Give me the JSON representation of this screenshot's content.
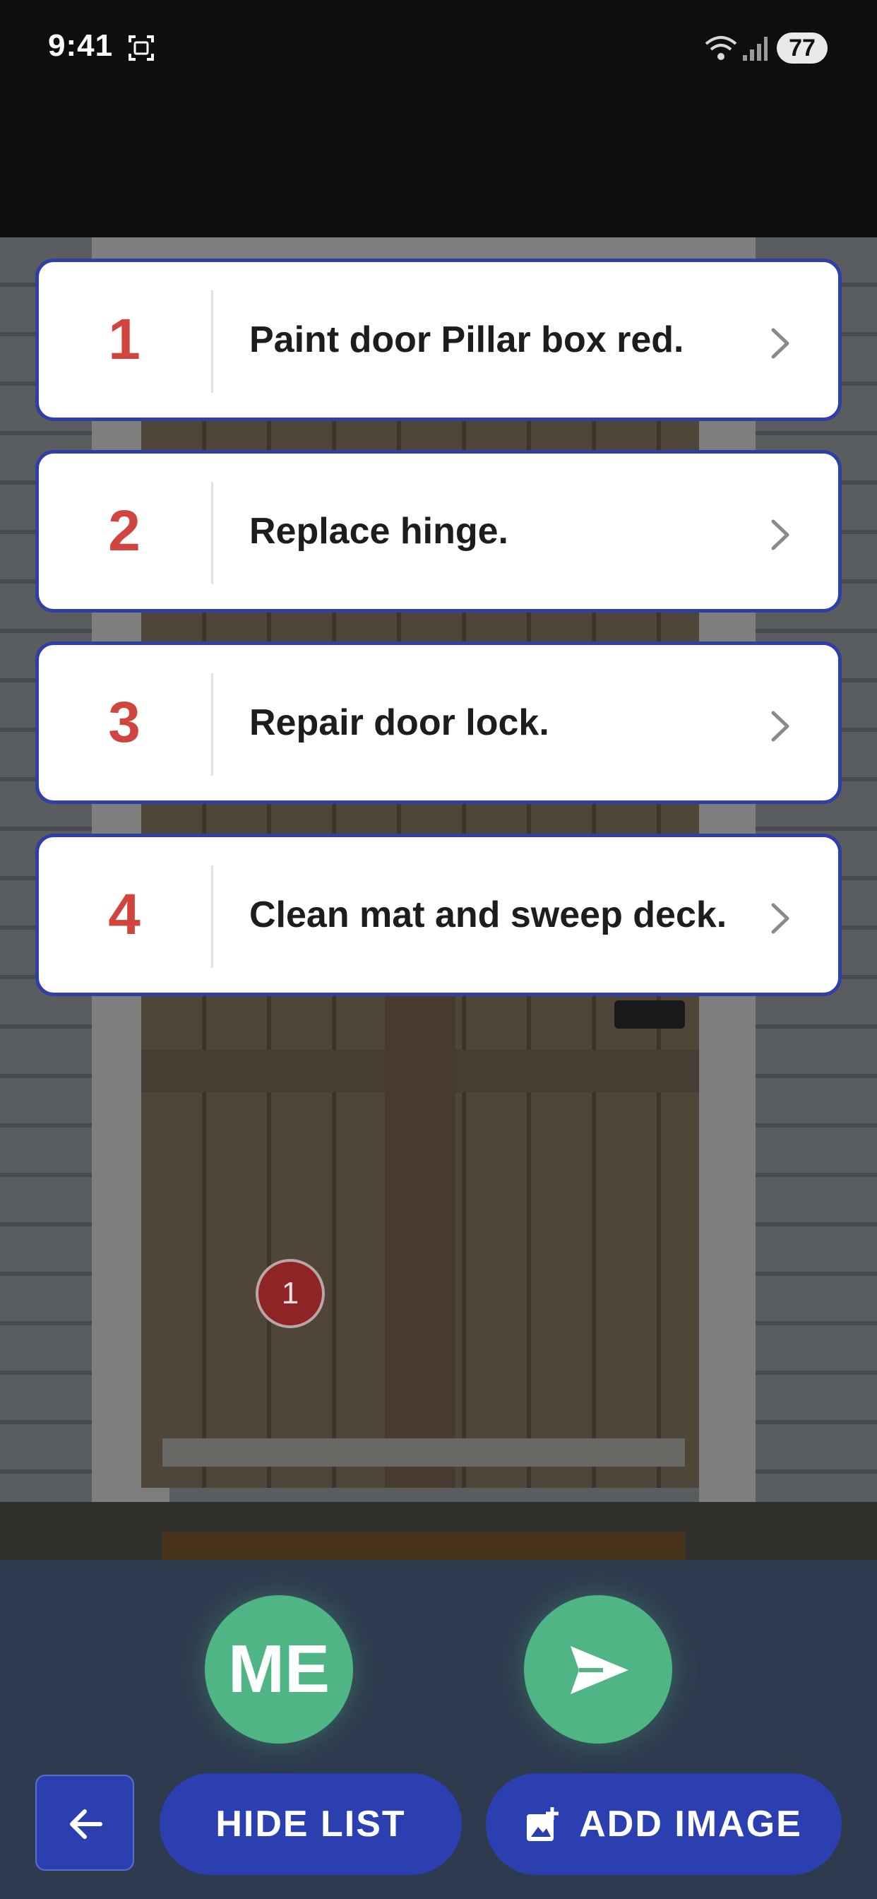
{
  "status_bar": {
    "time": "9:41",
    "battery": "77",
    "icons": [
      "screenshot-icon",
      "wifi-icon",
      "signal-icon",
      "battery-icon"
    ]
  },
  "photo_pin": {
    "label": "1"
  },
  "tasks": [
    {
      "number": "1",
      "label": "Paint door Pillar box red."
    },
    {
      "number": "2",
      "label": "Replace hinge."
    },
    {
      "number": "3",
      "label": "Repair door lock."
    },
    {
      "number": "4",
      "label": "Clean mat and sweep deck."
    }
  ],
  "actions": {
    "me_label": "ME",
    "hide_list_label": "HIDE LIST",
    "add_image_label": "ADD IMAGE"
  },
  "colors": {
    "card_border": "#2f3fa6",
    "number_red": "#d0463f",
    "accent_green": "#4fb585",
    "button_blue": "#2b3fb0",
    "panel_bg": "#2e3b4e"
  }
}
